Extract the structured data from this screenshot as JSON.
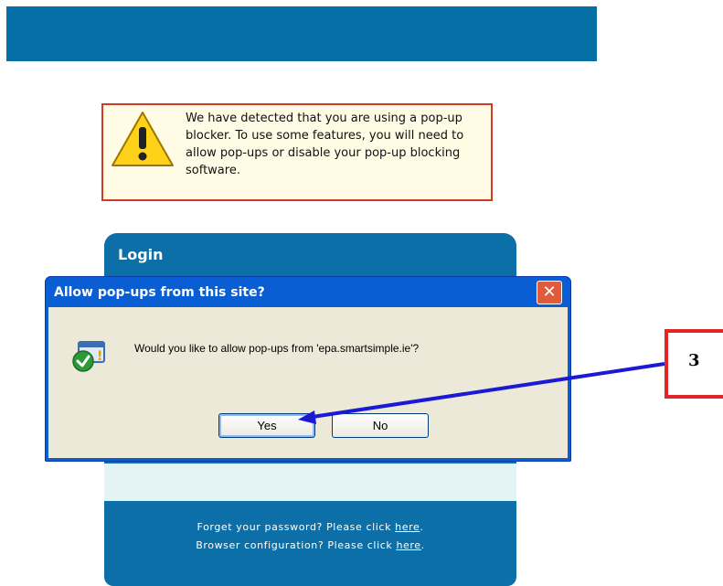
{
  "banner": {},
  "warning": {
    "message": "We have detected that you are using a pop-up blocker. To use some features, you will need to allow pop-ups or disable your pop-up blocking software.",
    "icon": "warning-icon"
  },
  "login": {
    "title": "Login",
    "forgot_prefix": "Forget your password? Please click ",
    "forgot_link": "here",
    "browser_prefix": "Browser configuration? Please click ",
    "browser_link": "here"
  },
  "dialog": {
    "title": "Allow pop-ups from this site?",
    "message": "Would you like to allow pop-ups from 'epa.smartsimple.ie'?",
    "yes_label": "Yes",
    "no_label": "No",
    "close_label": "✕",
    "icon": "popup-shield-icon"
  },
  "annotation": {
    "label": "3",
    "color": "#e22529",
    "arrow_color": "#1a1ad6"
  },
  "colors": {
    "banner": "#066fa6",
    "login_panel": "#0c6fa7",
    "dialog_titlebar": "#0a5ed4"
  }
}
